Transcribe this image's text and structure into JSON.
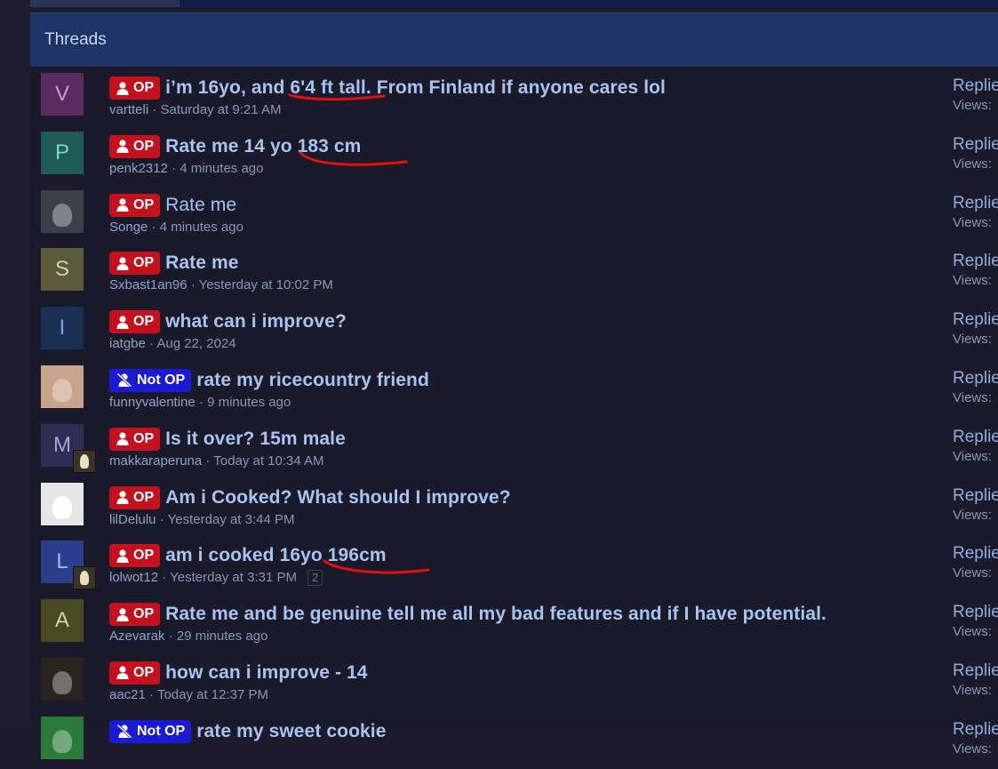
{
  "header": {
    "title": "Threads"
  },
  "stats_labels": {
    "replies": "Replie",
    "views": "Views:"
  },
  "badges": {
    "op": "OP",
    "not_op": "Not OP"
  },
  "threads": [
    {
      "avatar_letter": "V",
      "avatar_color": "#5b2a5e",
      "avatar_text_color": "#c79ad0",
      "badge": "op",
      "title": "i’m 16yo, and 6'4 ft tall. From Finland if anyone cares lol",
      "author": "vartteli",
      "time": "Saturday at 9:21 AM"
    },
    {
      "avatar_letter": "P",
      "avatar_color": "#1f5a55",
      "avatar_text_color": "#7fd6c8",
      "badge": "op",
      "title": "Rate me 14 yo 183 cm",
      "author": "penk2312",
      "time": "4 minutes ago"
    },
    {
      "avatar_letter": "",
      "avatar_color": "#3b3f4a",
      "avatar_text_color": "#ffffff",
      "badge": "op",
      "title": "Rate me",
      "author": "Songe",
      "time": "4 minutes ago",
      "title_weight": "normal"
    },
    {
      "avatar_letter": "S",
      "avatar_color": "#5b5a3a",
      "avatar_text_color": "#d6d3a0",
      "badge": "op",
      "title": "Rate me",
      "author": "Sxbast1an96",
      "time": "Yesterday at 10:02 PM"
    },
    {
      "avatar_letter": "I",
      "avatar_color": "#1a3052",
      "avatar_text_color": "#7fa6d6",
      "badge": "op",
      "title": "what can i improve?",
      "author": "iatgbe",
      "time": "Aug 22, 2024"
    },
    {
      "avatar_letter": "",
      "avatar_color": "#c9a48c",
      "avatar_text_color": "#ffffff",
      "badge": "not_op",
      "title": "rate my ricecountry friend",
      "author": "funnyvalentine",
      "time": "9 minutes ago"
    },
    {
      "avatar_letter": "M",
      "avatar_color": "#2e2e55",
      "avatar_text_color": "#a6a6dc",
      "badge": "op",
      "title": "Is it over? 15m male",
      "author": "makkaraperuna",
      "time": "Today at 10:34 AM",
      "mini": true
    },
    {
      "avatar_letter": "",
      "avatar_color": "#e6e6e6",
      "avatar_text_color": "#ffffff",
      "badge": "op",
      "title": "Am i Cooked? What should I improve?",
      "author": "lilDelulu",
      "time": "Yesterday at 3:44 PM"
    },
    {
      "avatar_letter": "L",
      "avatar_color": "#2a3e8c",
      "avatar_text_color": "#a6b8f0",
      "badge": "op",
      "title": "am i cooked 16yo 196cm",
      "author": "lolwot12",
      "time": "Yesterday at 3:31 PM",
      "page": "2",
      "mini": true
    },
    {
      "avatar_letter": "A",
      "avatar_color": "#4a4a22",
      "avatar_text_color": "#d3d39a",
      "badge": "op",
      "title": "Rate me and be genuine tell me all my bad features and if I have potential.",
      "author": "Azevarak",
      "time": "29 minutes ago"
    },
    {
      "avatar_letter": "",
      "avatar_color": "#2a2420",
      "avatar_text_color": "#ffffff",
      "badge": "op",
      "title": "how can i improve - 14",
      "author": "aac21",
      "time": "Today at 12:37 PM"
    },
    {
      "avatar_letter": "",
      "avatar_color": "#2a7a3a",
      "avatar_text_color": "#ffffff",
      "badge": "not_op",
      "title": "rate my sweet cookie",
      "author": "",
      "time": ""
    }
  ],
  "colors": {
    "op": "#c4111d",
    "not_op": "#1a1ad6",
    "header": "#1e3466",
    "link": "#a7c4ef",
    "annotation": "#e01010"
  },
  "icons": {
    "op": "user-icon",
    "not_op": "user-slash-icon"
  }
}
